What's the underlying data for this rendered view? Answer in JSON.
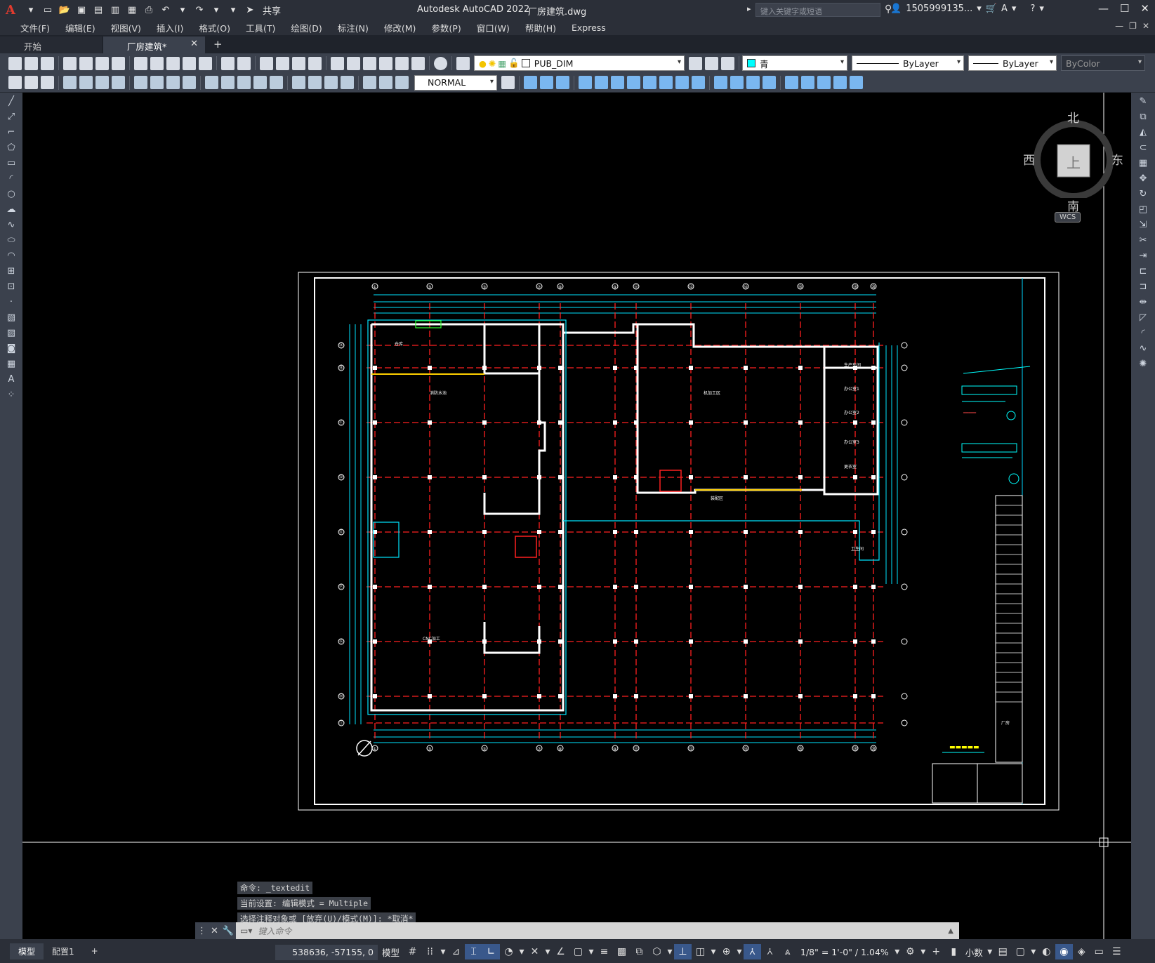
{
  "app": {
    "title": "Autodesk AutoCAD 2022",
    "document": "厂房建筑.dwg",
    "search_placeholder": "键入关键字或短语",
    "user": "1505999135...",
    "share_label": "共享"
  },
  "menu": [
    "文件(F)",
    "编辑(E)",
    "视图(V)",
    "插入(I)",
    "格式(O)",
    "工具(T)",
    "绘图(D)",
    "标注(N)",
    "修改(M)",
    "参数(P)",
    "窗口(W)",
    "帮助(H)",
    "Express"
  ],
  "tabs": {
    "start": "开始",
    "drawing": "厂房建筑*",
    "close": "✕",
    "add": "+"
  },
  "toolbar": {
    "layer": "PUB_DIM",
    "color": "青",
    "linetype": "ByLayer",
    "lineweight": "ByLayer",
    "plotstyle": "ByColor",
    "textstyle": "NORMAL"
  },
  "viewcube": {
    "north": "北",
    "south": "南",
    "west": "西",
    "east": "东",
    "top": "上",
    "wcs": "WCS"
  },
  "command": {
    "history": [
      "命令: _textedit",
      "当前设置: 编辑模式 = Multiple",
      "选择注释对象或 [放弃(U)/模式(M)]: *取消*"
    ],
    "placeholder": "键入命令"
  },
  "status": {
    "model_tab": "模型",
    "layout_tab": "配置1",
    "add": "+",
    "coords": "538636, -57155, 0",
    "space": "模型",
    "scale": "1/8\" = 1'-0\" / 1.04%",
    "units": "小数"
  },
  "drawing": {
    "column_labels": [
      "①",
      "③",
      "⑤",
      "⑦",
      "⑧",
      "⑨",
      "⑪",
      "⑫",
      "⑭",
      "⑯",
      "⑱",
      "⑳",
      "㉑"
    ],
    "row_labels": [
      "Ⓐ",
      "Ⓑ",
      "Ⓒ",
      "Ⓓ",
      "Ⓔ",
      "Ⓕ",
      "Ⓖ",
      "Ⓗ",
      "Ⓘ"
    ],
    "room_labels": [
      "仓库",
      "消防水池",
      "CNC加工",
      "机加工区",
      "装配区",
      "生产车间",
      "办公室1",
      "办公室2",
      "办公室3",
      "更衣室",
      "卫生间"
    ],
    "title_block": "厂房"
  }
}
